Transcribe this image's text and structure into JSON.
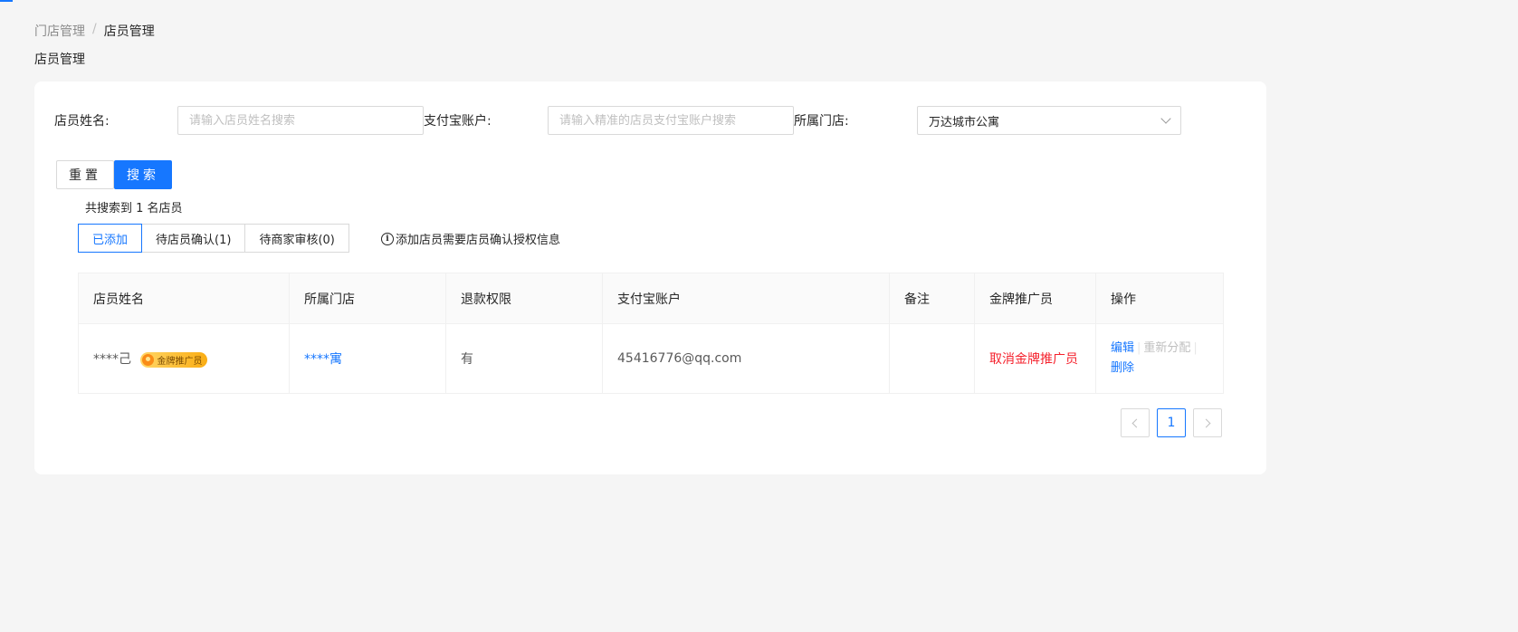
{
  "breadcrumb": {
    "parent": "门店管理",
    "separator": "/",
    "current": "店员管理"
  },
  "page_title": "店员管理",
  "filters": {
    "name_label": "店员姓名:",
    "name_placeholder": "请输入店员姓名搜索",
    "alipay_label": "支付宝账户:",
    "alipay_placeholder": "请输入精准的店员支付宝账户搜索",
    "store_label": "所属门店:",
    "store_value": "万达城市公寓"
  },
  "buttons": {
    "reset": "重置",
    "search": "搜索"
  },
  "result_count": "共搜索到 1 名店员",
  "tabs": [
    {
      "label": "已添加",
      "active": true
    },
    {
      "label": "待店员确认(1)",
      "active": false
    },
    {
      "label": "待商家审核(0)",
      "active": false
    }
  ],
  "notice": {
    "icon": "info-icon",
    "text": "添加店员需要店员确认授权信息"
  },
  "table": {
    "headers": [
      "店员姓名",
      "所属门店",
      "退款权限",
      "支付宝账户",
      "备注",
      "金牌推广员",
      "操作"
    ],
    "rows": [
      {
        "name": "****己",
        "badge": "金牌推广员",
        "store": "****寓",
        "refund": "有",
        "alipay": "45416776@qq.com",
        "remark": "",
        "gold_action": "取消金牌推广员",
        "actions": {
          "edit": "编辑",
          "reassign": "重新分配",
          "delete": "删除"
        }
      }
    ]
  },
  "pagination": {
    "current": "1"
  },
  "colors": {
    "primary": "#1677ff",
    "danger": "#f5222d",
    "badge": "#faad14"
  }
}
